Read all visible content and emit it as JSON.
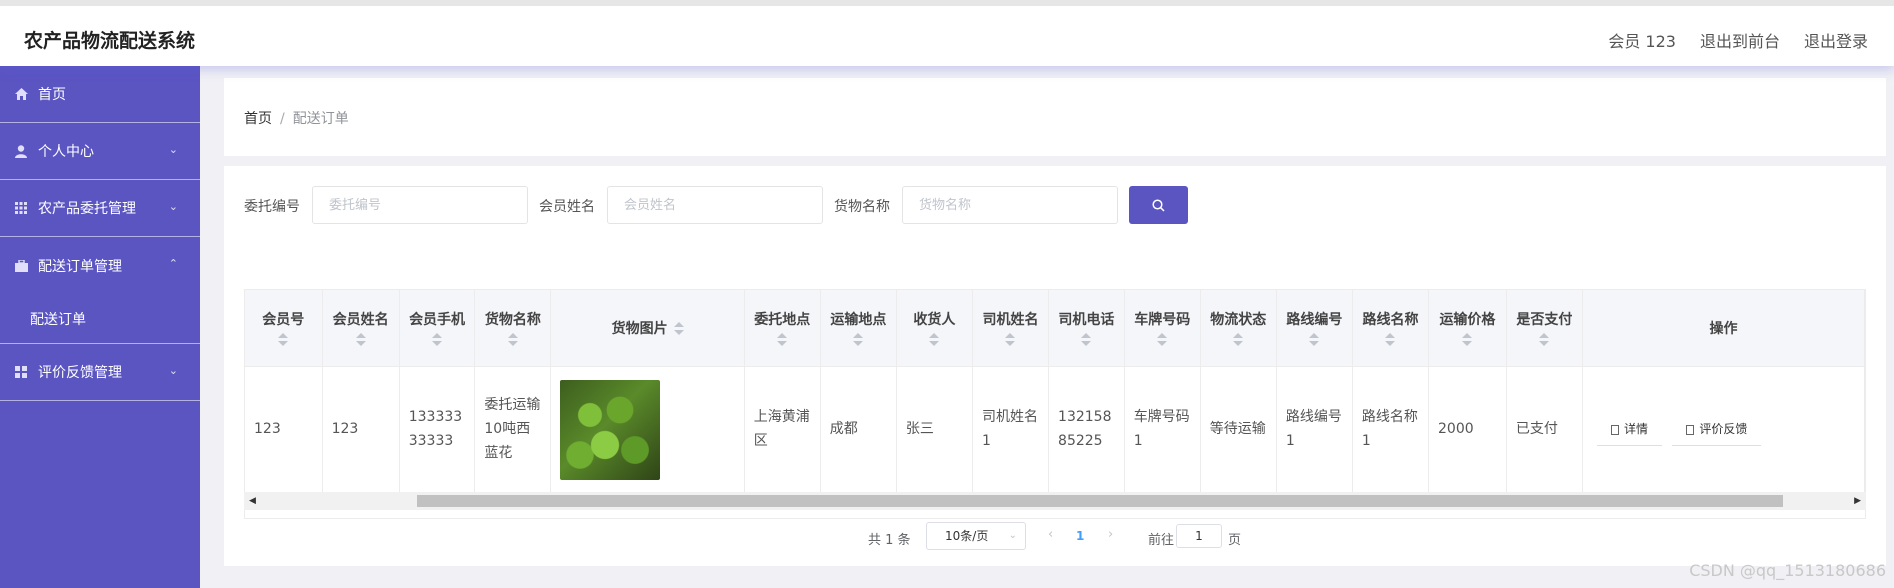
{
  "header": {
    "title": "农产品物流配送系统",
    "user": "会员 123",
    "front": "退出到前台",
    "logout": "退出登录"
  },
  "sidebar": {
    "items": [
      {
        "label": "首页"
      },
      {
        "label": "个人中心"
      },
      {
        "label": "农产品委托管理"
      },
      {
        "label": "配送订单管理",
        "sub": "配送订单"
      },
      {
        "label": "评价反馈管理"
      }
    ]
  },
  "breadcrumb": {
    "home": "首页",
    "current": "配送订单"
  },
  "search": [
    {
      "label": "委托编号",
      "placeholder": "委托编号"
    },
    {
      "label": "会员姓名",
      "placeholder": "会员姓名"
    },
    {
      "label": "货物名称",
      "placeholder": "货物名称"
    }
  ],
  "table": {
    "headers": [
      "会员号",
      "会员姓名",
      "会员手机",
      "货物名称",
      "货物图片",
      "委托地点",
      "运输地点",
      "收货人",
      "司机姓名",
      "司机电话",
      "车牌号码",
      "物流状态",
      "路线编号",
      "路线名称",
      "运输价格",
      "是否支付",
      "操作"
    ],
    "row": [
      "123",
      "123",
      "13333333333",
      "委托运输10吨西蓝花",
      "",
      "上海黄浦区",
      "成都",
      "张三",
      "司机姓名1",
      "13215885225",
      "车牌号码1",
      "等待运输",
      "路线编号1",
      "路线名称1",
      "2000",
      "已支付"
    ],
    "actions": [
      "详情",
      "评价反馈"
    ]
  },
  "pager": {
    "total": "共 1 条",
    "size": "10条/页",
    "page": "1",
    "goto": "前往",
    "jump": "1",
    "unit": "页"
  },
  "watermark": "CSDN @qq_1513180686"
}
